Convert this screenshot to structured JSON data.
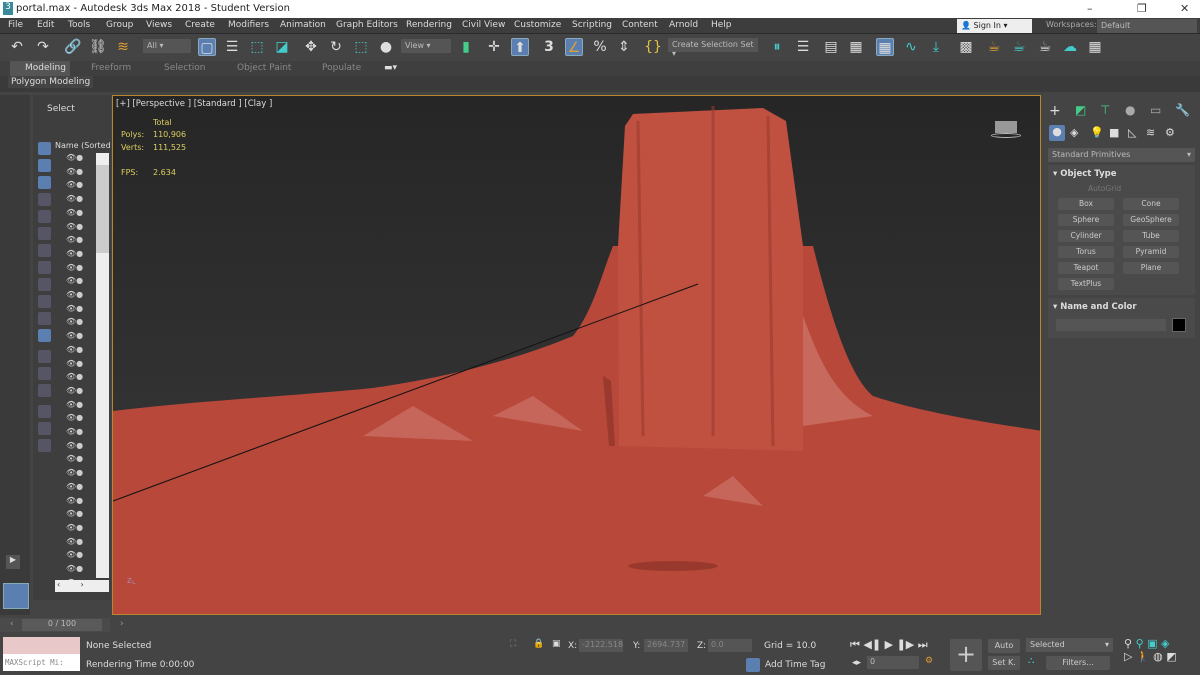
{
  "window": {
    "title": "portal.max - Autodesk 3ds Max 2018 - Student Version",
    "minimize": "–",
    "restore": "❐",
    "close": "✕"
  },
  "menu": [
    "File",
    "Edit",
    "Tools",
    "Group",
    "Views",
    "Create",
    "Modifiers",
    "Animation",
    "Graph Editors",
    "Rendering",
    "Civil View",
    "Customize",
    "Scripting",
    "Content",
    "Arnold",
    "Help"
  ],
  "account": {
    "sign_in": "Sign In",
    "workspaces_label": "Workspaces:",
    "workspace": "Default"
  },
  "toolbar": {
    "selection_filter": "All",
    "ref_coord": "View",
    "selection_set": "Create Selection Set",
    "snap_label": "3"
  },
  "ribbon": {
    "tabs": [
      "Modeling",
      "Freeform",
      "Selection",
      "Object Paint",
      "Populate"
    ],
    "active": "Modeling",
    "panel": "Polygon Modeling"
  },
  "explorer": {
    "title": "Select",
    "column": "Name (Sorted"
  },
  "viewport": {
    "label": "[+] [Perspective ] [Standard ] [Clay ]",
    "stats_header": "Total",
    "polys_label": "Polys:",
    "polys": "110,906",
    "verts_label": "Verts:",
    "verts": "111,525",
    "fps_label": "FPS:",
    "fps": "2.634",
    "terrain_color": "#c0503f"
  },
  "command_panel": {
    "category": "Standard Primitives",
    "object_type": "Object Type",
    "autogrid": "AutoGrid",
    "buttons": [
      "Box",
      "Cone",
      "Sphere",
      "GeoSphere",
      "Cylinder",
      "Tube",
      "Torus",
      "Pyramid",
      "Teapot",
      "Plane",
      "TextPlus"
    ],
    "name_and_color": "Name and Color",
    "color": "#000000"
  },
  "timeline": {
    "frame": "0 / 100"
  },
  "status": {
    "maxscript": "MAXScript Mi:",
    "selection": "None Selected",
    "render_time": "Rendering Time  0:00:00",
    "x_label": "X:",
    "x": "-2122.518",
    "y_label": "Y:",
    "y": "2694.737",
    "z_label": "Z:",
    "z": "0.0",
    "grid": "Grid = 10.0",
    "add_time_tag": "Add Time Tag",
    "auto": "Auto",
    "setkey": "Set K.",
    "key_filter": "Selected",
    "filters": "Filters...",
    "current_frame": "0"
  }
}
